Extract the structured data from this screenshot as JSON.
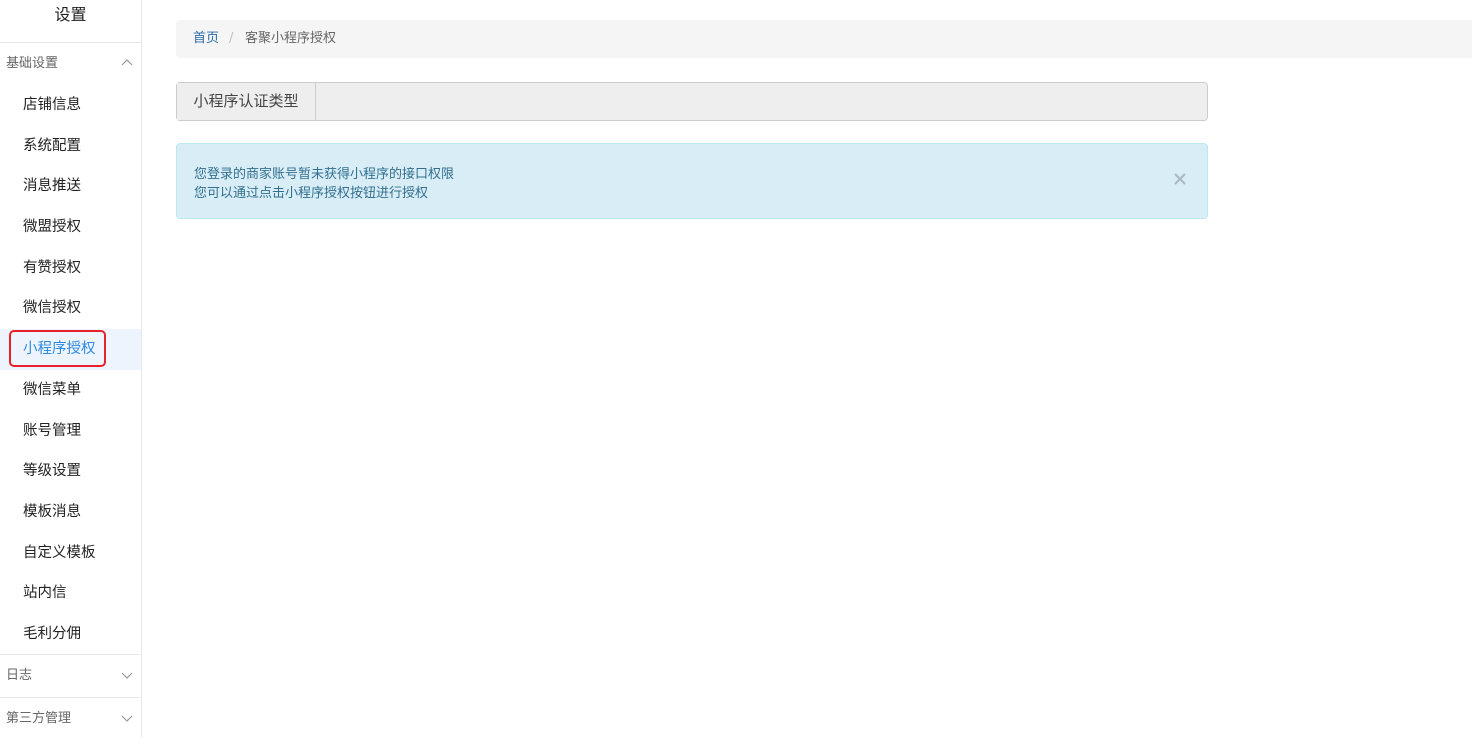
{
  "sidebar": {
    "title": "设置",
    "groups": [
      {
        "label": "基础设置",
        "expanded": true,
        "items": [
          {
            "label": "店铺信息"
          },
          {
            "label": "系统配置"
          },
          {
            "label": "消息推送"
          },
          {
            "label": "微盟授权"
          },
          {
            "label": "有赞授权"
          },
          {
            "label": "微信授权"
          },
          {
            "label": "小程序授权",
            "active": true
          },
          {
            "label": "微信菜单"
          },
          {
            "label": "账号管理"
          },
          {
            "label": "等级设置"
          },
          {
            "label": "模板消息"
          },
          {
            "label": "自定义模板"
          },
          {
            "label": "站内信"
          },
          {
            "label": "毛利分佣"
          }
        ]
      },
      {
        "label": "日志",
        "expanded": false
      },
      {
        "label": "第三方管理",
        "expanded": false
      }
    ]
  },
  "breadcrumb": {
    "home": "首页",
    "separator": "/",
    "current": "客聚小程序授权"
  },
  "form": {
    "auth_type_label": "小程序认证类型",
    "auth_type_value": ""
  },
  "alert": {
    "line1": "您登录的商家账号暂未获得小程序的接口权限",
    "line2": "您可以通过点击小程序授权按钮进行授权",
    "close_icon": "close-icon"
  },
  "colors": {
    "active_text": "#2f8ae0",
    "active_bg": "#edf4fd",
    "highlight_border": "#e9202a",
    "alert_bg": "#d9edf7",
    "alert_text": "#31708f",
    "link": "#2a6aa8"
  }
}
